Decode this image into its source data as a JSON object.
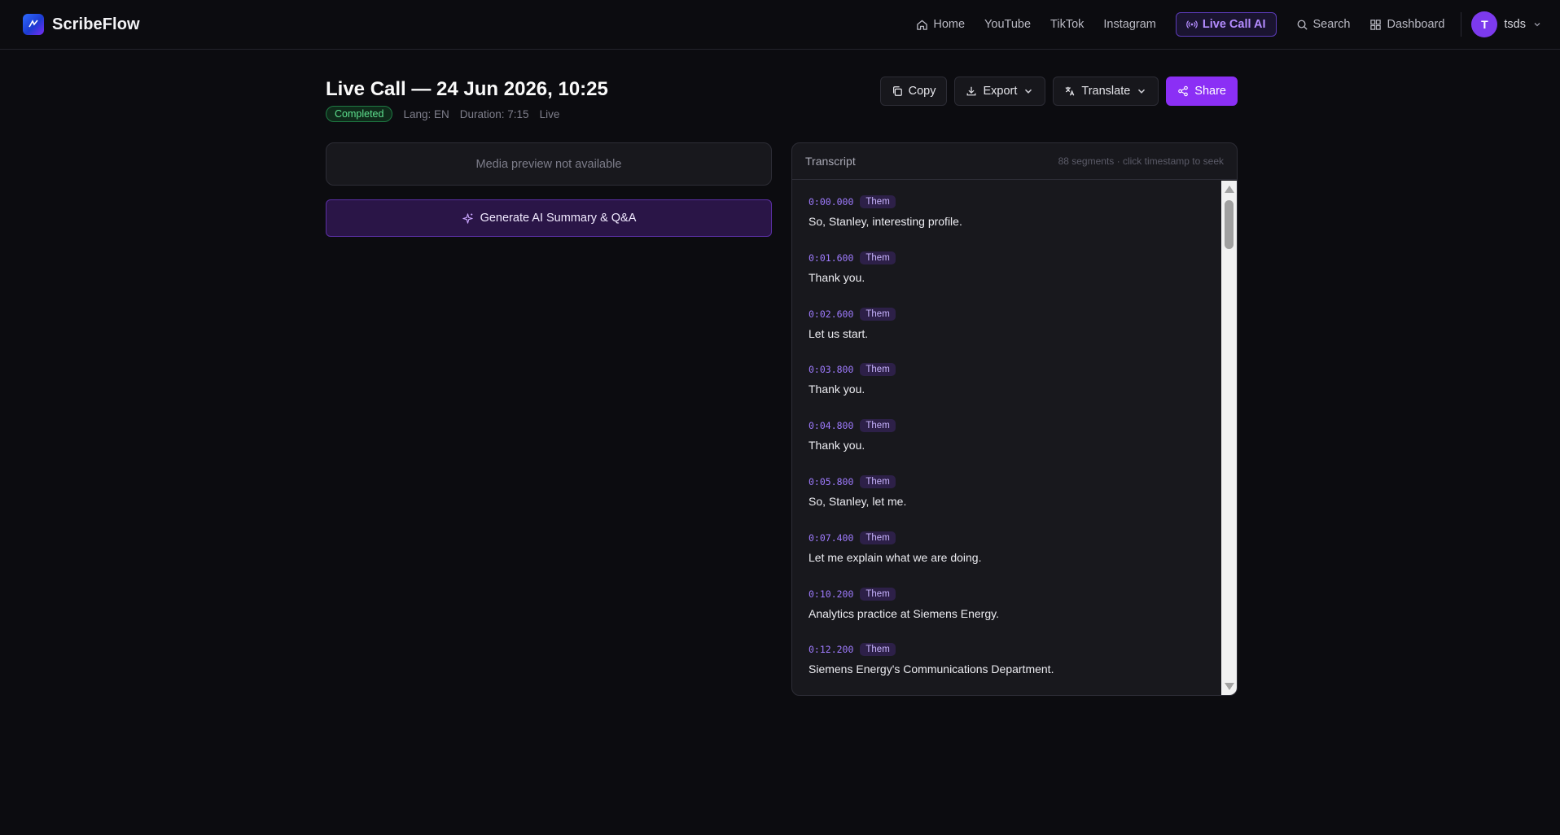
{
  "brand": {
    "name": "ScribeFlow"
  },
  "nav": {
    "home": "Home",
    "youtube": "YouTube",
    "tiktok": "TikTok",
    "instagram": "Instagram",
    "live_call": "Live Call AI",
    "search": "Search",
    "dashboard": "Dashboard"
  },
  "user": {
    "initial": "T",
    "name": "tsds"
  },
  "page": {
    "title": "Live Call — 24 Jun 2026, 10:25",
    "status": "Completed",
    "lang": "Lang: EN",
    "duration": "Duration: 7:15",
    "source": "Live"
  },
  "actions": {
    "copy": "Copy",
    "export": "Export",
    "translate": "Translate",
    "share": "Share"
  },
  "media": {
    "placeholder": "Media preview not available"
  },
  "generate": {
    "label": "Generate AI Summary & Q&A"
  },
  "transcript": {
    "title": "Transcript",
    "hint": "88 segments · click timestamp to seek",
    "segments": [
      {
        "time": "0:00.000",
        "speaker": "Them",
        "text": "So, Stanley, interesting profile."
      },
      {
        "time": "0:01.600",
        "speaker": "Them",
        "text": "Thank you."
      },
      {
        "time": "0:02.600",
        "speaker": "Them",
        "text": "Let us start."
      },
      {
        "time": "0:03.800",
        "speaker": "Them",
        "text": "Thank you."
      },
      {
        "time": "0:04.800",
        "speaker": "Them",
        "text": "Thank you."
      },
      {
        "time": "0:05.800",
        "speaker": "Them",
        "text": "So, Stanley, let me."
      },
      {
        "time": "0:07.400",
        "speaker": "Them",
        "text": "Let me explain what we are doing."
      },
      {
        "time": "0:10.200",
        "speaker": "Them",
        "text": "Analytics practice at Siemens Energy."
      },
      {
        "time": "0:12.200",
        "speaker": "Them",
        "text": "Siemens Energy's Communications Department."
      }
    ]
  },
  "colors": {
    "accent": "#8b2ff5",
    "background": "#0c0c10",
    "success": "#5ee08f"
  }
}
